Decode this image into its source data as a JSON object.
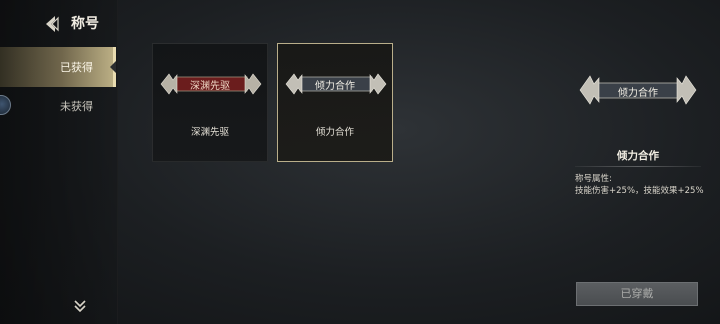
{
  "header": {
    "title": "称号"
  },
  "sidebar": {
    "tabs": [
      {
        "label": "已获得"
      },
      {
        "label": "未获得"
      }
    ]
  },
  "cards": [
    {
      "name": "深渊先驱",
      "banner_text": "深渊先驱",
      "banner_color": "#6b1d1d",
      "banner_text_color": "#f0d9c6"
    },
    {
      "name": "倾力合作",
      "banner_text": "倾力合作",
      "banner_color": "#3a4048",
      "banner_text_color": "#f2efe6"
    }
  ],
  "detail": {
    "badge_text": "倾力合作",
    "name": "倾力合作",
    "attr_label": "称号属性:",
    "attr_value": "技能伤害+25%，技能效果+25%"
  },
  "actions": {
    "equip_label": "已穿戴"
  },
  "icons": [
    "back-arrow-icon",
    "expand-more-icon",
    "wing-ornament-icon"
  ]
}
